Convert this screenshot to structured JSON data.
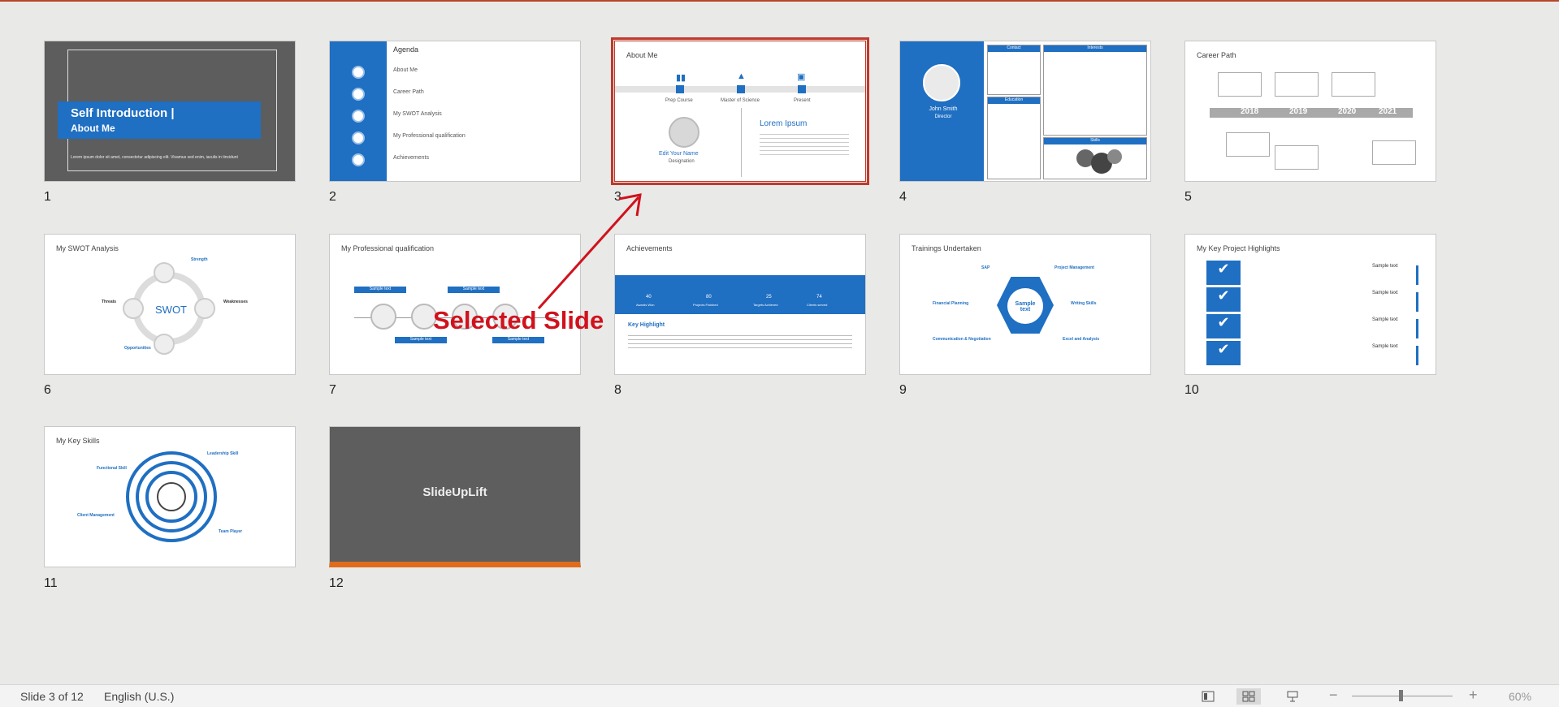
{
  "accent": "#1f6fc2",
  "selection_color": "#c0392b",
  "annotation": {
    "text": "Selected Slide",
    "color": "#d0121d"
  },
  "slides": [
    {
      "number": "1",
      "title": "Self Introduction |",
      "subtitle": "About Me",
      "body": "Lorem ipsum dolor sit amet, consectetur adipiscing elit. Vivamus sed enim, iaculis in tincidunt"
    },
    {
      "number": "2",
      "title": "Agenda",
      "items": [
        "About Me",
        "Career Path",
        "My SWOT Analysis",
        "My Professional qualification",
        "Achievements"
      ]
    },
    {
      "number": "3",
      "title": "About Me",
      "steps": [
        "Prep Course",
        "Master of Science",
        "Present"
      ],
      "name": "Edit Your Name",
      "designation": "Designation",
      "heading": "Lorem Ipsum"
    },
    {
      "number": "4",
      "name": "John Smith",
      "role": "Director",
      "sections": [
        "Contact",
        "Interests",
        "Education",
        "Skills"
      ]
    },
    {
      "number": "5",
      "title": "Career Path",
      "years": [
        "2018",
        "2019",
        "2020",
        "2021"
      ]
    },
    {
      "number": "6",
      "title": "My SWOT Analysis",
      "center": "SWOT",
      "labels": [
        "Strength",
        "Threats",
        "Weaknesses",
        "Opportunities"
      ]
    },
    {
      "number": "7",
      "title": "My Professional qualification",
      "tag": "Sample text"
    },
    {
      "number": "8",
      "title": "Achievements",
      "stats": [
        "40",
        "80",
        "25",
        "74"
      ],
      "stat_labels": [
        "Awards Won",
        "Projects Finished",
        "Targets Achieved",
        "Clients served"
      ],
      "subheading": "Key Highlight"
    },
    {
      "number": "9",
      "title": "Trainings Undertaken",
      "center": "Sample text",
      "labels": [
        "SAP",
        "Project Management",
        "Financial Planning",
        "Writing Skills",
        "Communication & Negotiation",
        "Excel and Analysis"
      ]
    },
    {
      "number": "10",
      "title": "My Key Project Highlights",
      "tag": "Sample text"
    },
    {
      "number": "11",
      "title": "My Key Skills",
      "labels": [
        "Functional Skill",
        "Leadership Skill",
        "Client Management",
        "Team Player"
      ]
    },
    {
      "number": "12",
      "brand": "SlideUpLift"
    }
  ],
  "status": {
    "slide_info": "Slide 3 of 12",
    "language": "English (U.S.)",
    "zoom": "60%",
    "zoom_level": 0.6
  }
}
